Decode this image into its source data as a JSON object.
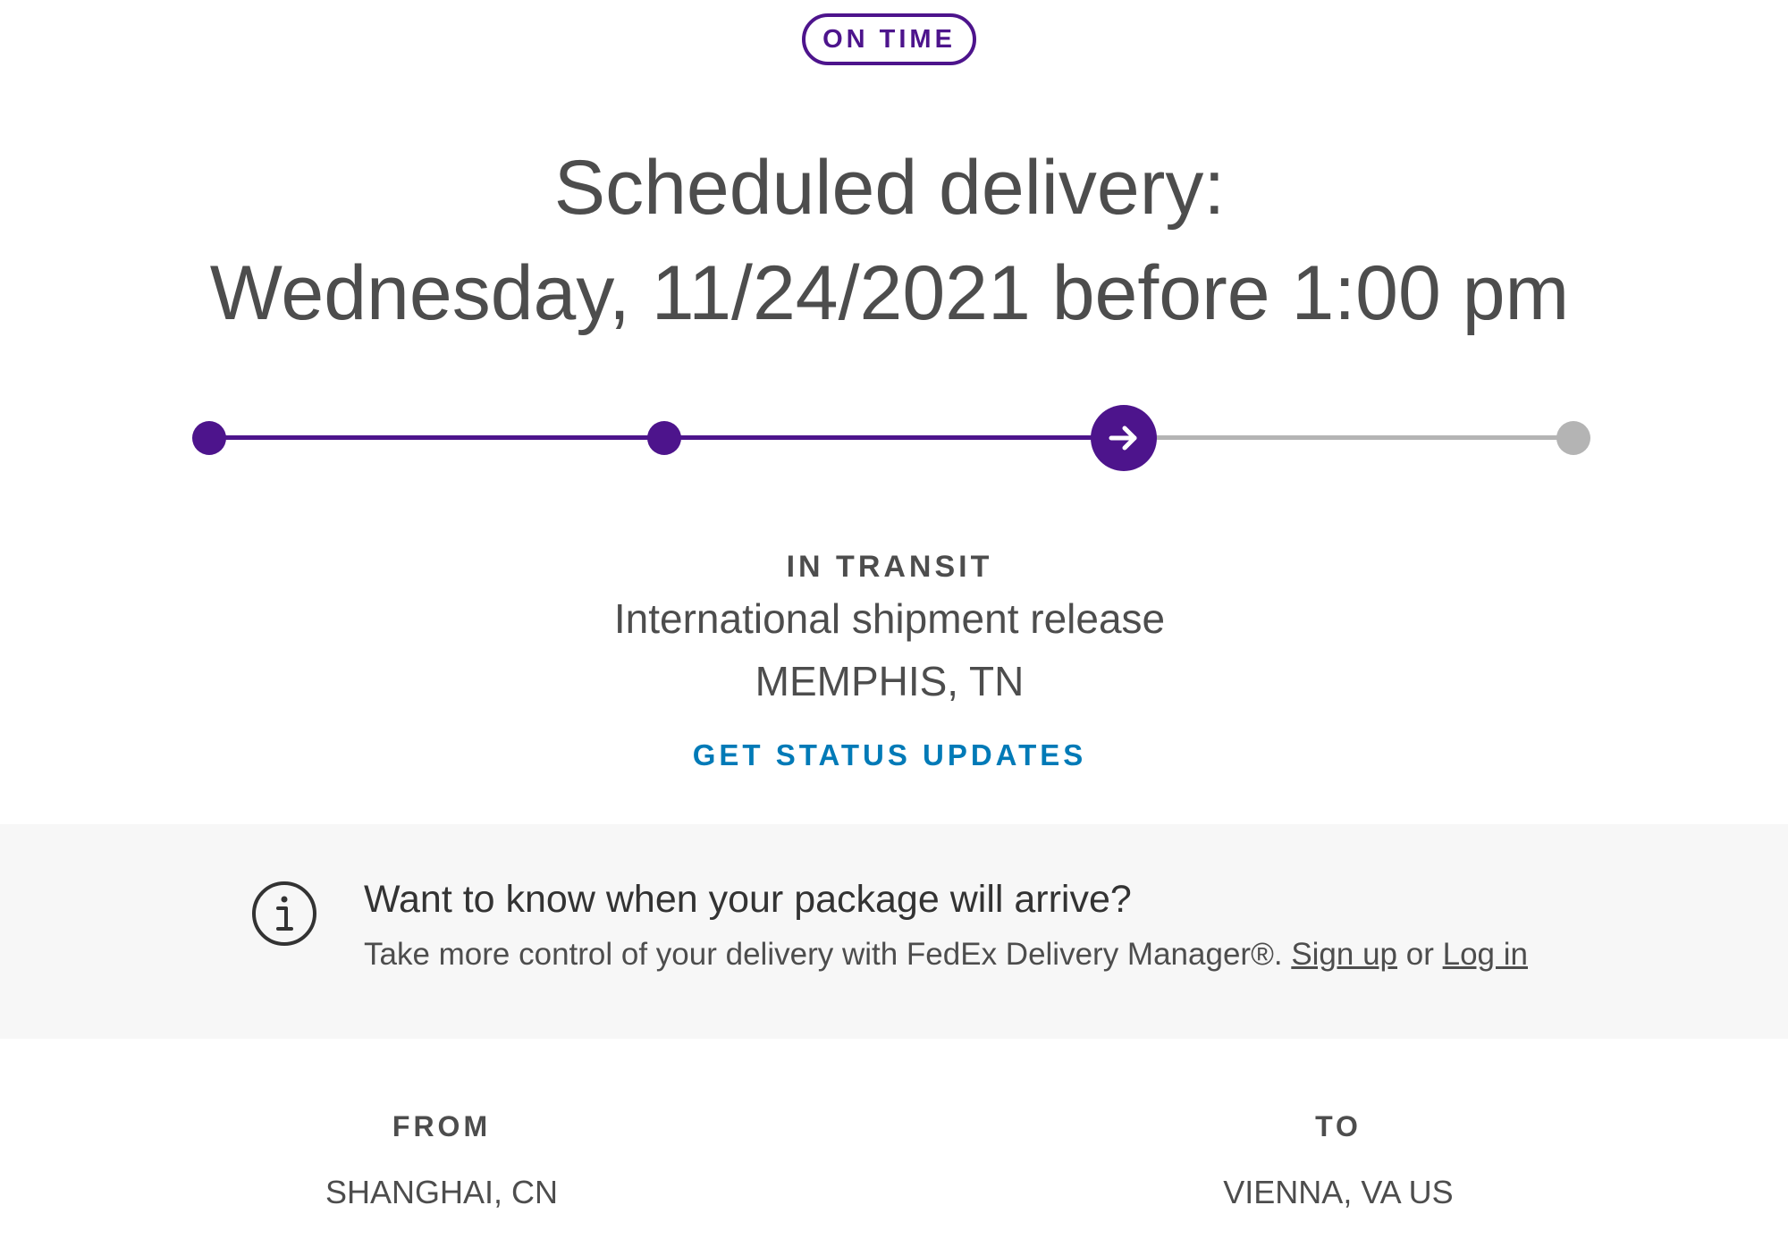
{
  "status_badge": "ON TIME",
  "headline": {
    "line1": "Scheduled delivery:",
    "line2": "Wednesday, 11/24/2021 before 1:00 pm"
  },
  "progress": {
    "steps_total": 4,
    "current_step": 3,
    "current_icon": "arrow-right-icon",
    "colors": {
      "done": "#4d148c",
      "todo": "#b4b4b4"
    }
  },
  "status": {
    "label": "IN TRANSIT",
    "description": "International shipment release",
    "location": "MEMPHIS, TN",
    "updates_link": "GET STATUS UPDATES"
  },
  "banner": {
    "icon": "info-icon",
    "title": "Want to know when your package will arrive?",
    "text_prefix": "Take more control of your delivery with FedEx Delivery Manager®.",
    "signup_label": "Sign up",
    "or_text": "or",
    "login_label": "Log in"
  },
  "shipment": {
    "from_label": "FROM",
    "from_value": "SHANGHAI, CN",
    "to_label": "TO",
    "to_value": "VIENNA, VA US"
  },
  "colors": {
    "brand_purple": "#4d148c",
    "link_blue": "#007ab7",
    "banner_bg": "#f7f7f7"
  }
}
